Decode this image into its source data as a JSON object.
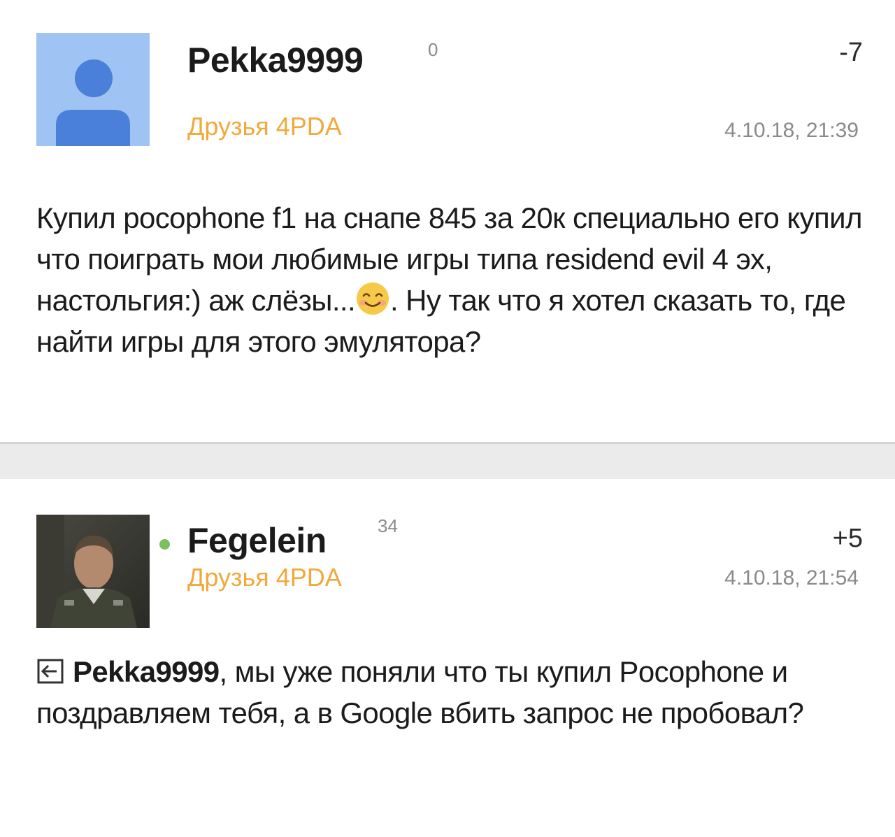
{
  "posts": [
    {
      "author": "Pekka9999",
      "reputation": "0",
      "group": "Друзья 4PDA",
      "score": "-7",
      "datetime": "4.10.18, 21:39",
      "body_part1": "Купил pocophone f1 на снапе 845 за 20к специально его купил что поиграть мои любимые игры типа residend evil 4 эх, настольгия:) аж слёзы...",
      "body_part2": ". Ну так что я хотел сказать то, где найти игры для этого эмулятора?",
      "emoji": "smiling-face-emoji",
      "avatar": "default-user-avatar",
      "online": false
    },
    {
      "author": "Fegelein",
      "reputation": "34",
      "group": "Друзья 4PDA",
      "score": "+5",
      "datetime": "4.10.18, 21:54",
      "reply_to": "Pekka9999",
      "body": ", мы уже поняли что ты купил Pocophone и поздравляем тебя, а в Google вбить запрос не пробовал?",
      "avatar": "user-photo-avatar",
      "online": true
    }
  ],
  "colors": {
    "group": "#f0a93a",
    "online": "#7cbf5f",
    "default_avatar_bg": "#9fc3f2",
    "default_avatar_figure": "#4a80d9",
    "separator": "#ebebeb"
  }
}
